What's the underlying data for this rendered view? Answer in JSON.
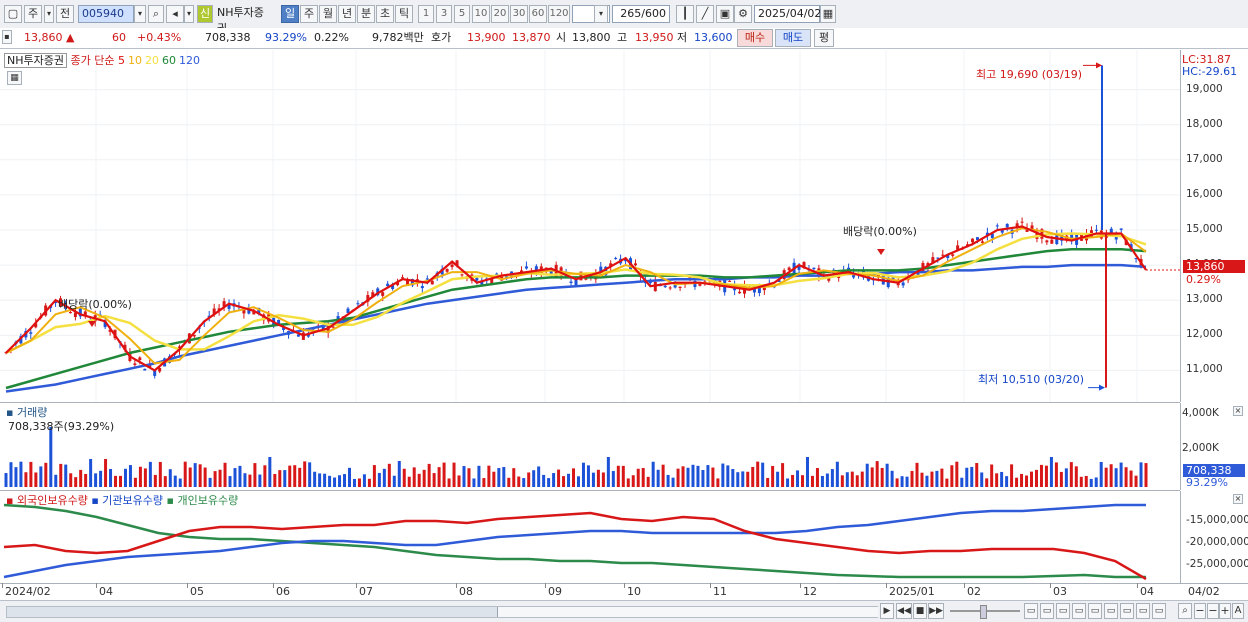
{
  "toolbar": {
    "period_select": "주",
    "all_label": "전",
    "code": "005940",
    "badge": "신",
    "stock_name": "NH투자증권",
    "period_buttons": [
      "일",
      "주",
      "월",
      "년",
      "분",
      "초",
      "틱"
    ],
    "n_buttons": [
      "1",
      "3",
      "5",
      "10",
      "20",
      "30",
      "60",
      "120"
    ],
    "count": "265",
    "total": "/600",
    "date": "2025/04/02"
  },
  "quote": {
    "price": "13,860",
    "arrow": "▲",
    "change": "60",
    "change_pct": "+0.43%",
    "volume": "708,338",
    "volume_pct": "93.29%",
    "turnover_pct": "0.22%",
    "amount": "9,782백만",
    "hoga_label": "호가",
    "ask": "13,900",
    "bid": "13,870",
    "open_label": "시",
    "open": "13,800",
    "high_label": "고",
    "high": "13,950",
    "low_label": "저",
    "low": "13,600",
    "buy_button": "매수",
    "sell_button": "매도",
    "eval_button": "평"
  },
  "price_pane": {
    "name_label": "NH투자증권",
    "legend_prefix": "종가 단순",
    "ma": [
      {
        "label": "5",
        "color": "#e01010"
      },
      {
        "label": "10",
        "color": "#f0b010"
      },
      {
        "label": "20",
        "color": "#f4e040"
      },
      {
        "label": "60",
        "color": "#208838"
      },
      {
        "label": "120",
        "color": "#2f5ad8"
      }
    ],
    "lc": "LC:31.87",
    "hc": "HC:-29.61",
    "y_ticks": [
      "19,000",
      "18,000",
      "17,000",
      "16,000",
      "15,000",
      "14,000",
      "13,000",
      "12,000",
      "11,000"
    ],
    "current_price_tag": "13,860",
    "current_pct_tag": "0.29%",
    "high_note": "최고 19,690 (03/19)",
    "low_note": "최저 10,510 (03/20)",
    "div_note_1": "배당락(0.00%)",
    "div_note_2": "배당락(0.00%)"
  },
  "volume_pane": {
    "title": "거래량",
    "value_label": "708,338주(93.29%)",
    "y_ticks": [
      "4,000K",
      "2,000K"
    ],
    "tag_value": "708,338",
    "tag_pct": "93.29%"
  },
  "holding_pane": {
    "legend": [
      "외국인보유수량",
      "기관보유수량",
      "개인보유수량"
    ],
    "colors": [
      "#d81818",
      "#2f5ad8",
      "#2c8a4a"
    ],
    "y_ticks": [
      "-15,000,000",
      "-20,000,000",
      "-25,000,000"
    ]
  },
  "x_axis": [
    "2024/02",
    "04",
    "05",
    "06",
    "07",
    "08",
    "09",
    "10",
    "11",
    "12",
    "2025/01",
    "02",
    "03",
    "04"
  ],
  "x_axis_right": "04/02",
  "chart_data": {
    "type": "line",
    "title": "NH투자증권",
    "ylim": [
      10300,
      19900
    ],
    "series": [
      {
        "name": "종가 단순 5",
        "values": [
          11500,
          12200,
          13000,
          12600,
          12400,
          11400,
          11000,
          11600,
          12400,
          12900,
          12700,
          12300,
          12000,
          12200,
          12700,
          13200,
          13600,
          13500,
          14100,
          13500,
          13700,
          13800,
          13900,
          13600,
          13800,
          14200,
          13400,
          13500,
          13500,
          13400,
          13300,
          13500,
          14000,
          13700,
          13800,
          13600,
          13500,
          13900,
          14300,
          14600,
          15000,
          15100,
          14800,
          14700,
          14900,
          14900,
          13860
        ]
      },
      {
        "name": "종가 단순 60",
        "values": [
          10500,
          10700,
          10900,
          11100,
          11300,
          11500,
          11650,
          11800,
          11950,
          12100,
          12200,
          12300,
          12350,
          12400,
          12500,
          12700,
          12900,
          13100,
          13300,
          13400,
          13500,
          13600,
          13650,
          13650,
          13650,
          13700,
          13700,
          13700,
          13700,
          13650,
          13650,
          13700,
          13750,
          13800,
          13850,
          13850,
          13850,
          13900,
          14000,
          14100,
          14200,
          14300,
          14400,
          14450,
          14450,
          14450,
          14400
        ]
      },
      {
        "name": "종가 단순 120",
        "values": [
          10400,
          10500,
          10600,
          10750,
          10900,
          11050,
          11200,
          11400,
          11550,
          11700,
          11850,
          12000,
          12150,
          12300,
          12450,
          12600,
          12750,
          12900,
          13000,
          13100,
          13200,
          13300,
          13350,
          13400,
          13450,
          13500,
          13550,
          13600,
          13600,
          13600,
          13650,
          13650,
          13700,
          13700,
          13750,
          13750,
          13800,
          13800,
          13850,
          13850,
          13900,
          13950,
          13950,
          14000,
          14000,
          14000,
          13950
        ]
      }
    ]
  }
}
